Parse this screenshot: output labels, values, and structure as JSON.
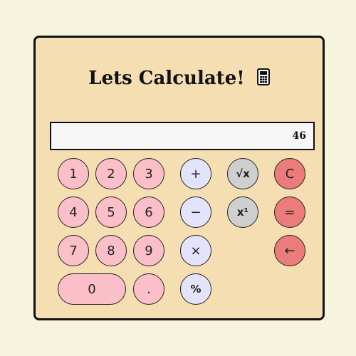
{
  "title": "Lets Calculate!",
  "title_icon": "calculator-icon",
  "display_value": "46",
  "buttons": {
    "one": "1",
    "two": "2",
    "three": "3",
    "four": "4",
    "five": "5",
    "six": "6",
    "seven": "7",
    "eight": "8",
    "nine": "9",
    "zero": "0",
    "decimal": ".",
    "plus": "+",
    "minus": "−",
    "multiply": "×",
    "percent": "%",
    "sqrt": "√x",
    "power": "x¹",
    "clear": "C",
    "equals": "=",
    "backspace": "←"
  },
  "colors": {
    "background": "#f6f4dc",
    "body": "#f5deb2",
    "number_button": "#fbbfc9",
    "operator_button": "#e3e3fb",
    "function_button": "#cfcfcf",
    "action_button": "#ec7b7b"
  }
}
